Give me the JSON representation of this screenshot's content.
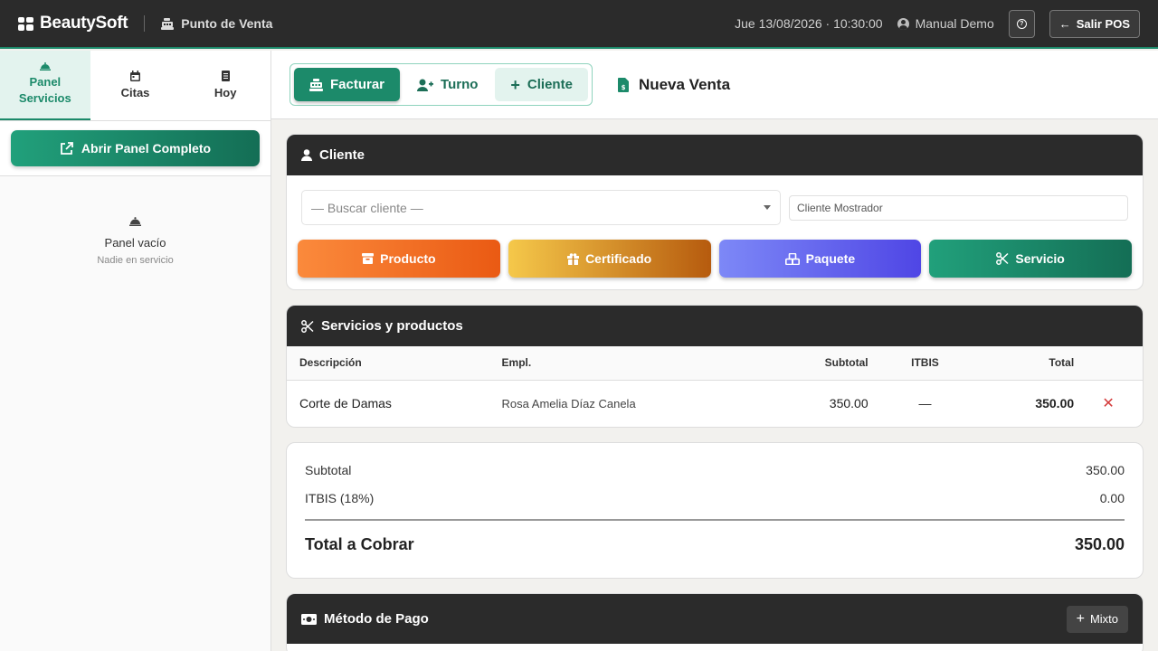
{
  "app": {
    "brand": "BeautySoft",
    "module": "Punto de Venta",
    "datetime": "Jue 13/08/2026 · 10:30:00",
    "user": "Manual Demo",
    "exit_label": "Salir POS"
  },
  "sidebar": {
    "tabs": [
      {
        "label": "Panel Servicios",
        "active": true
      },
      {
        "label": "Citas",
        "active": false
      },
      {
        "label": "Hoy",
        "active": false
      }
    ],
    "open_panel_label": "Abrir Panel Completo",
    "empty_title": "Panel vacío",
    "empty_subtitle": "Nadie en servicio"
  },
  "main": {
    "actions": [
      {
        "label": "Facturar",
        "active": true
      },
      {
        "label": "Turno",
        "active": false
      },
      {
        "label": "Cliente",
        "active": false
      }
    ],
    "page_title": "Nueva Venta"
  },
  "client": {
    "title": "Cliente",
    "search_placeholder": "— Buscar cliente —",
    "name_placeholder": "Cliente Mostrador",
    "categories": [
      {
        "label": "Producto",
        "color_from": "#fb8a3c",
        "color_to": "#ea5a13"
      },
      {
        "label": "Certificado",
        "color_from": "#f5c84a",
        "color_to": "#b65b0e"
      },
      {
        "label": "Paquete",
        "color_from": "#7d88f7",
        "color_to": "#4f46e5"
      },
      {
        "label": "Servicio",
        "color_from": "#21a07b",
        "color_to": "#146e55"
      }
    ]
  },
  "items": {
    "title": "Servicios y productos",
    "columns": [
      "Descripción",
      "Empl.",
      "Subtotal",
      "ITBIS",
      "Total"
    ],
    "rows": [
      {
        "description": "Corte de Damas",
        "employee": "Rosa Amelia Díaz Canela",
        "subtotal": "350.00",
        "itbis": "—",
        "total": "350.00"
      }
    ]
  },
  "totals": {
    "subtotal_label": "Subtotal",
    "subtotal_value": "350.00",
    "itbis_label": "ITBIS (18%)",
    "itbis_value": "0.00",
    "grand_label": "Total a Cobrar",
    "grand_value": "350.00"
  },
  "payment": {
    "title": "Método de Pago",
    "mixed_label": "Mixto"
  },
  "colors": {
    "accent": "#1c8a6a",
    "dark": "#2b2b2b",
    "danger": "#d43b3b"
  }
}
